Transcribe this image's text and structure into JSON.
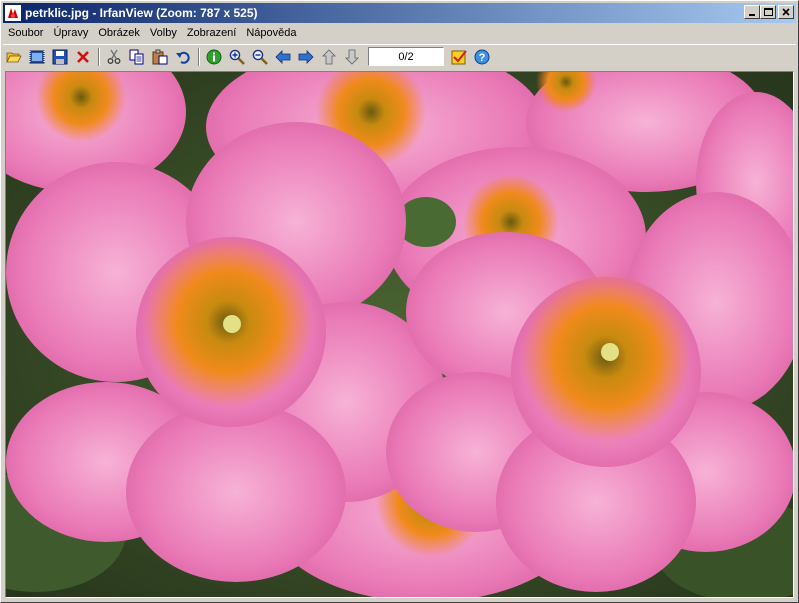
{
  "window": {
    "title": "petrklic.jpg - IrfanView (Zoom: 787 x 525)",
    "buttons": {
      "minimize": "_",
      "maximize": "□",
      "close": "X"
    }
  },
  "menu": {
    "items": [
      "Soubor",
      "Úpravy",
      "Obrázek",
      "Volby",
      "Zobrazení",
      "Nápověda"
    ]
  },
  "toolbar": {
    "icons": [
      "open-icon",
      "slideshow-icon",
      "save-icon",
      "delete-icon",
      "cut-icon",
      "copy-icon",
      "paste-icon",
      "undo-icon",
      "info-icon",
      "zoom-in-icon",
      "zoom-out-icon",
      "previous-icon",
      "next-icon",
      "first-icon",
      "last-icon"
    ],
    "page_counter": "0/2",
    "extra_icons": [
      "options-icon",
      "help-icon"
    ]
  },
  "image": {
    "file": "petrklic.jpg",
    "description_colors": {
      "petal": "#e97ab5",
      "petal_light": "#f3a6cf",
      "center": "#f08a1c",
      "eye": "#e3e085",
      "leaf": "#3f5a2c"
    }
  }
}
